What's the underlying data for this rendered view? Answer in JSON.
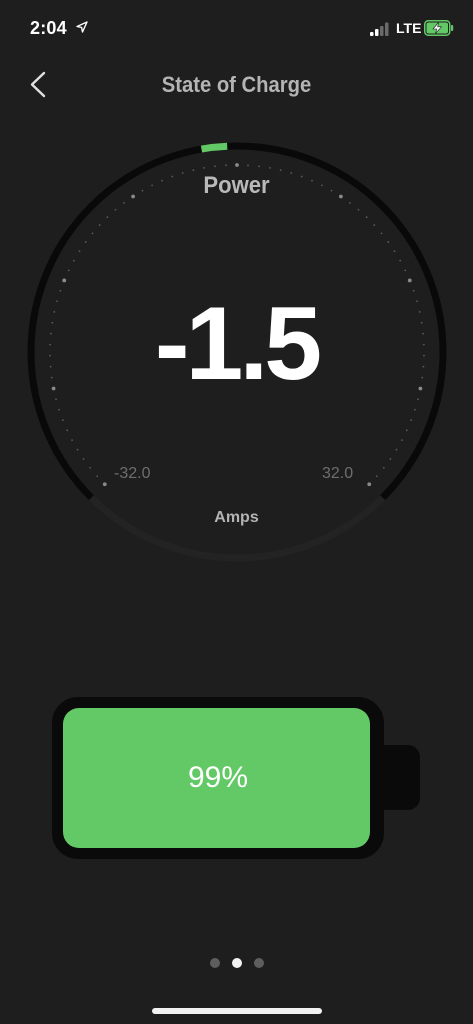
{
  "status_bar": {
    "time": "2:04",
    "network": "LTE",
    "icons": [
      "location-arrow-icon",
      "signal-icon",
      "battery-charging-icon"
    ]
  },
  "nav": {
    "title": "State of Charge",
    "back_icon": "chevron-left-icon"
  },
  "gauge": {
    "title": "Power",
    "value": "-1.5",
    "min_label": "-32.0",
    "max_label": "32.0",
    "unit": "Amps",
    "min": -32.0,
    "max": 32.0,
    "current": -1.5,
    "colors": {
      "track": "#090909",
      "indicator": "#63c966",
      "tick": "#5a5a5a"
    }
  },
  "battery": {
    "percent_label": "99%",
    "level": 0.99,
    "fill_color": "#63c966"
  },
  "pager": {
    "pages": 3,
    "active_index": 1
  }
}
